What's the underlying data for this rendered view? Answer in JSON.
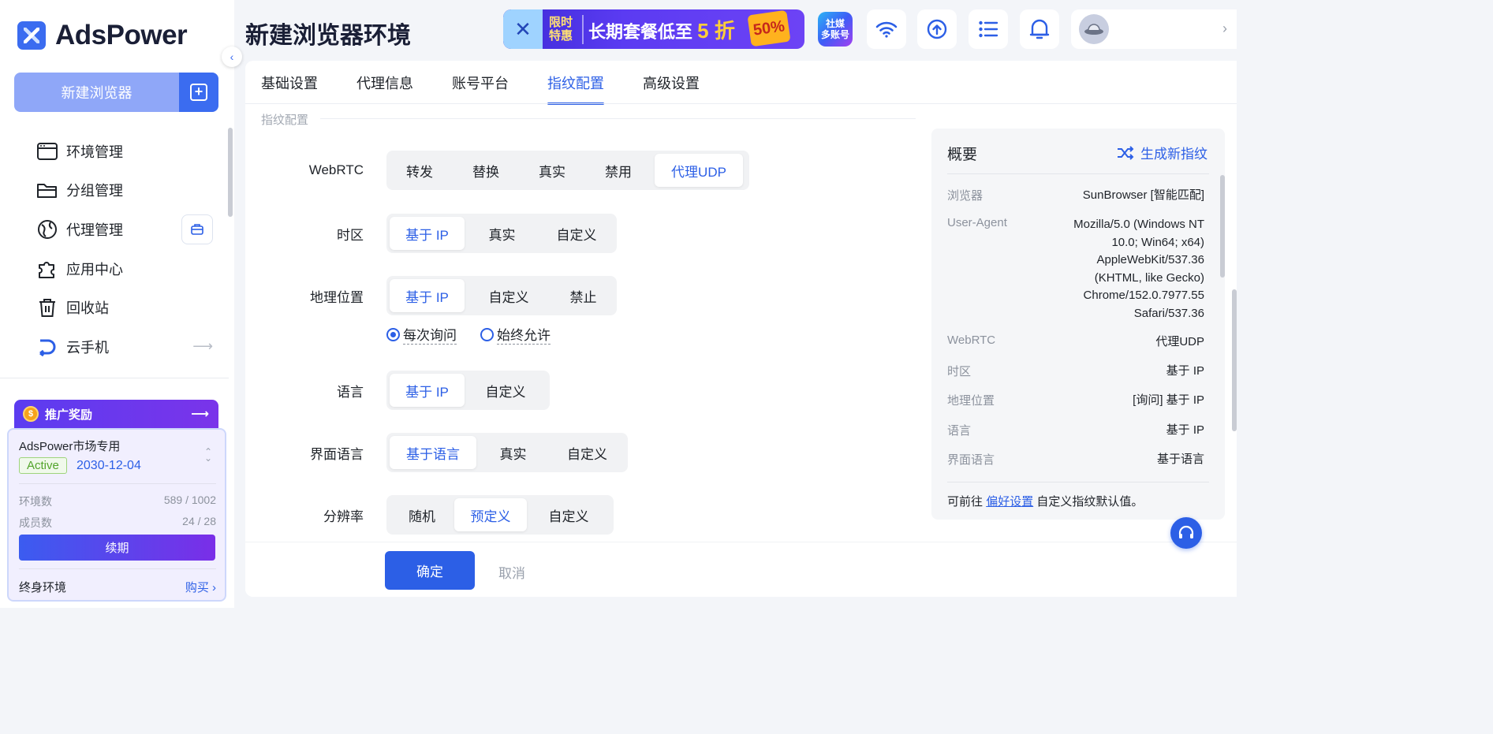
{
  "app": {
    "logo_text": "AdsPower",
    "new_browser_label": "新建浏览器"
  },
  "sidebar": {
    "items": [
      {
        "label": "环境管理",
        "icon": "window-icon"
      },
      {
        "label": "分组管理",
        "icon": "folder-icon"
      },
      {
        "label": "代理管理",
        "icon": "globe-icon"
      },
      {
        "label": "应用中心",
        "icon": "puzzle-icon"
      },
      {
        "label": "回收站",
        "icon": "trash-icon"
      },
      {
        "label": "云手机",
        "icon": "cloud-phone-icon"
      }
    ]
  },
  "promo": {
    "title": "推广奖励",
    "account_name": "AdsPower市场专用",
    "status": "Active",
    "expiry": "2030-12-04",
    "env_label": "环境数",
    "env_value": "589 / 1002",
    "member_label": "成员数",
    "member_value": "24 / 28",
    "renew_label": "续期",
    "lifetime_label": "终身环境",
    "buy_label": "购买"
  },
  "header": {
    "title": "新建浏览器环境",
    "banner": {
      "tag_line1": "限时",
      "tag_line2": "特惠",
      "text": "长期套餐低至",
      "highlight": "5 折",
      "badge": "50%"
    },
    "social_line1": "社媒",
    "social_line2": "多账号"
  },
  "tabs": [
    "基础设置",
    "代理信息",
    "账号平台",
    "指纹配置",
    "高级设置"
  ],
  "active_tab": "指纹配置",
  "section_title": "指纹配置",
  "form": {
    "webrtc": {
      "label": "WebRTC",
      "options": [
        "转发",
        "替换",
        "真实",
        "禁用",
        "代理UDP"
      ],
      "selected": "代理UDP"
    },
    "timezone": {
      "label": "时区",
      "options": [
        "基于 IP",
        "真实",
        "自定义"
      ],
      "selected": "基于 IP"
    },
    "geo": {
      "label": "地理位置",
      "options": [
        "基于 IP",
        "自定义",
        "禁止"
      ],
      "selected": "基于 IP"
    },
    "geo_prompt": {
      "ask": "每次询问",
      "allow": "始终允许",
      "selected": "每次询问"
    },
    "language": {
      "label": "语言",
      "options": [
        "基于 IP",
        "自定义"
      ],
      "selected": "基于 IP"
    },
    "ui_language": {
      "label": "界面语言",
      "options": [
        "基于语言",
        "真实",
        "自定义"
      ],
      "selected": "基于语言"
    },
    "resolution": {
      "label": "分辨率",
      "options": [
        "随机",
        "预定义",
        "自定义"
      ],
      "selected": "预定义"
    }
  },
  "footer": {
    "confirm": "确定",
    "cancel": "取消"
  },
  "overview": {
    "title": "概要",
    "generate": "生成新指纹",
    "rows": [
      {
        "k": "浏览器",
        "v": "SunBrowser [智能匹配]"
      },
      {
        "k": "User-Agent",
        "v": "Mozilla/5.0 (Windows NT 10.0; Win64; x64) AppleWebKit/537.36 (KHTML, like Gecko) Chrome/152.0.7977.55 Safari/537.36"
      },
      {
        "k": "WebRTC",
        "v": "代理UDP"
      },
      {
        "k": "时区",
        "v": "基于 IP"
      },
      {
        "k": "地理位置",
        "v": "[询问] 基于 IP"
      },
      {
        "k": "语言",
        "v": "基于 IP"
      },
      {
        "k": "界面语言",
        "v": "基于语言"
      }
    ],
    "note_prefix": "可前往",
    "note_link": "偏好设置",
    "note_suffix": "自定义指纹默认值。"
  },
  "colors": {
    "accent": "#2c5fe6",
    "brand": "#3b6cf0",
    "promo": "#6a3ef0"
  }
}
